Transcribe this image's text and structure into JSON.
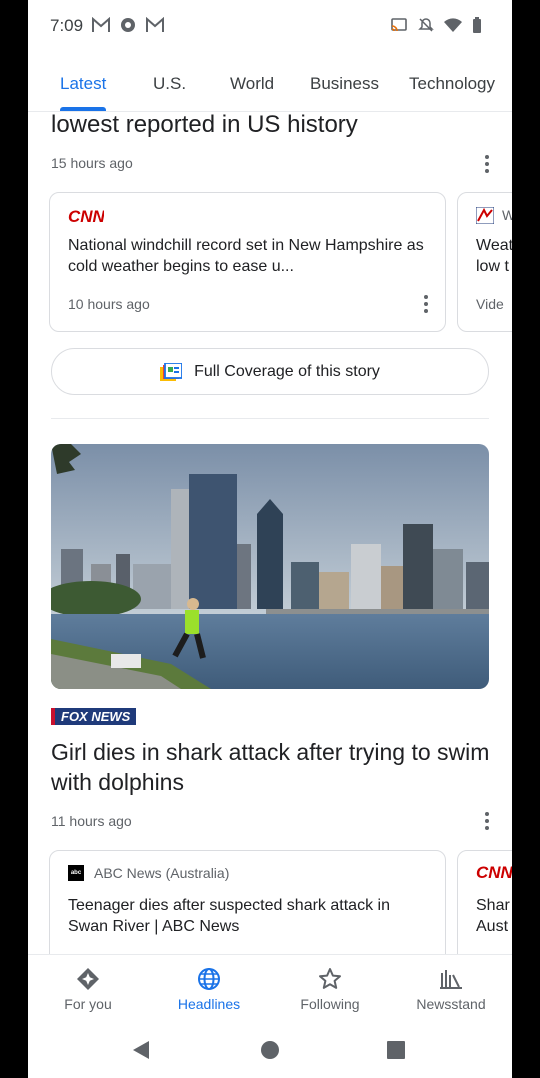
{
  "status_bar": {
    "time": "7:09"
  },
  "tabs": [
    {
      "label": "Latest"
    },
    {
      "label": "U.S."
    },
    {
      "label": "World"
    },
    {
      "label": "Business"
    },
    {
      "label": "Technology"
    }
  ],
  "story1": {
    "headline_partial": "lowest reported in US history",
    "time": "15 hours ago",
    "related": [
      {
        "source": "CNN",
        "title": "National windchill record set in New Hampshire as cold weather begins to ease u...",
        "time": "10 hours ago"
      },
      {
        "source_partial": "W",
        "title_partial": "Weat low t",
        "time_partial": "Vide"
      }
    ],
    "full_coverage_label": "Full Coverage of this story"
  },
  "story2": {
    "source": "FOX NEWS",
    "headline": "Girl dies in shark attack after trying to swim with dolphins",
    "time": "11 hours ago",
    "related": [
      {
        "source": "ABC News (Australia)",
        "title": "Teenager dies after suspected shark attack in Swan River | ABC News"
      },
      {
        "source": "CNN",
        "title_partial": "Shar Aust"
      }
    ]
  },
  "bottom_nav": [
    {
      "label": "For you"
    },
    {
      "label": "Headlines"
    },
    {
      "label": "Following"
    },
    {
      "label": "Newsstand"
    }
  ],
  "colors": {
    "accent": "#1a73e8",
    "cnn_red": "#cc0000",
    "fox_blue": "#1f3a7a"
  }
}
